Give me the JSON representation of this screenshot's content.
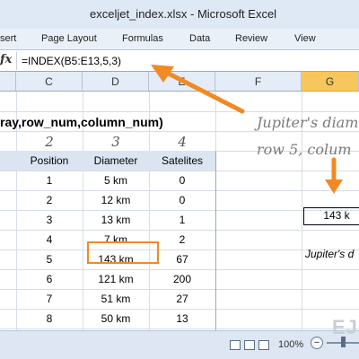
{
  "window": {
    "title": "exceljet_index.xlsx - Microsoft Excel"
  },
  "ribbon": {
    "tabs": [
      "sert",
      "Page Layout",
      "Formulas",
      "Data",
      "Review",
      "View"
    ]
  },
  "formula_bar": {
    "fx_label": "fx",
    "formula": "=INDEX(B5:E13,5,3)"
  },
  "columns": [
    "C",
    "D",
    "E",
    "F",
    "G"
  ],
  "active_column": "G",
  "syntax": "ray,row_num,column_num)",
  "column_index_numbers": [
    "2",
    "3",
    "4"
  ],
  "table": {
    "headers": [
      "Position",
      "Diameter",
      "Satelites"
    ],
    "rows": [
      [
        "1",
        "5 km",
        "0"
      ],
      [
        "2",
        "12 km",
        "0"
      ],
      [
        "3",
        "13 km",
        "1"
      ],
      [
        "4",
        "7 km",
        "2"
      ],
      [
        "5",
        "143 km",
        "67"
      ],
      [
        "6",
        "121 km",
        "200"
      ],
      [
        "7",
        "51 km",
        "27"
      ],
      [
        "8",
        "50 km",
        "13"
      ]
    ]
  },
  "annotation": {
    "line1": "Jupiter's diam",
    "line2": "row 5, colum"
  },
  "result": {
    "value": "143 k",
    "caption": "Jupiter's d"
  },
  "status_bar": {
    "zoom": "100%"
  },
  "watermark": "EJ",
  "colors": {
    "highlight": "#f08a24",
    "active_header": "#f7c75d",
    "header_fill": "#dbe5f1"
  }
}
